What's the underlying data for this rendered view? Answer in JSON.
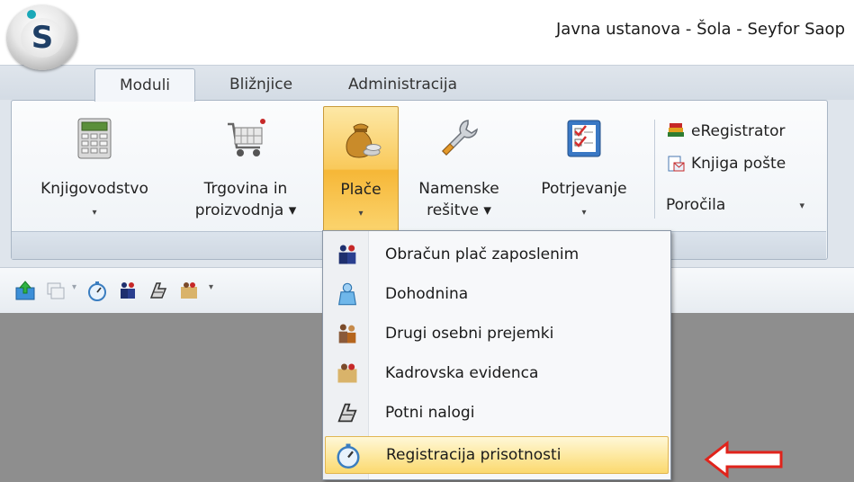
{
  "window": {
    "title": "Javna ustanova - Šola - Seyfor Saop",
    "logo_letter": "S"
  },
  "tabs": [
    {
      "label": "Moduli",
      "active": true
    },
    {
      "label": "Bližnjice",
      "active": false
    },
    {
      "label": "Administracija",
      "active": false
    }
  ],
  "ribbon": {
    "buttons": [
      {
        "line1": "Knjigovodstvo",
        "line2": "▾",
        "icon": "calculator-icon"
      },
      {
        "line1": "Trgovina in",
        "line2": "proizvodnja ▾",
        "icon": "shopping-cart-icon"
      },
      {
        "line1": "Plače",
        "line2": "▾",
        "icon": "money-bag-icon",
        "pressed": true
      },
      {
        "line1": "Namenske",
        "line2": "rešitve ▾",
        "icon": "wrench-icon"
      },
      {
        "line1": "Potrjevanje",
        "line2": "▾",
        "icon": "checklist-icon"
      }
    ],
    "small_items": [
      {
        "label": "eRegistrator",
        "icon": "books-icon"
      },
      {
        "label": "Knjiga pošte",
        "icon": "mail-book-icon"
      },
      {
        "label": "Poročila",
        "icon": ""
      }
    ],
    "porocila_arrow": "▾"
  },
  "qat": {
    "more": "▾"
  },
  "dropdown": {
    "items": [
      {
        "label": "Obračun plač zaposlenim",
        "icon": "people-payroll-icon"
      },
      {
        "label": "Dohodnina",
        "icon": "income-tax-icon"
      },
      {
        "label": "Drugi osebni prejemki",
        "icon": "personal-income-icon"
      },
      {
        "label": "Kadrovska evidenca",
        "icon": "staff-records-icon"
      },
      {
        "label": "Potni nalogi",
        "icon": "travel-order-icon"
      },
      {
        "label": "Registracija prisotnosti",
        "icon": "stopwatch-icon",
        "highlighted": true
      }
    ]
  },
  "colors": {
    "accent_red": "#e0231b",
    "highlight": "#fbd96f",
    "workspace": "#8e8e8e"
  }
}
